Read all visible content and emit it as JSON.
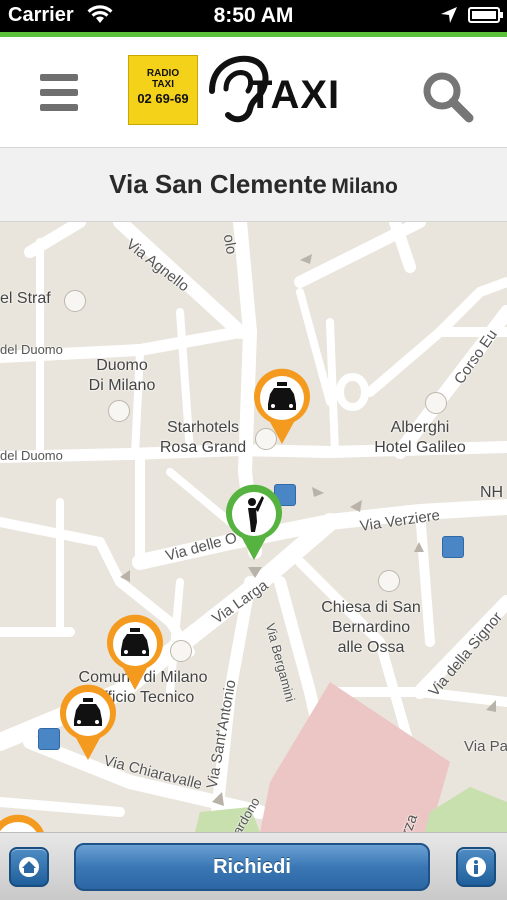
{
  "status_bar": {
    "carrier": "Carrier",
    "time": "8:50 AM"
  },
  "header": {
    "logo_badge_line1": "RADIO",
    "logo_badge_line2": "TAXI",
    "logo_badge_line3": "02 69-69",
    "logo_text": "TAXI"
  },
  "address": {
    "street": "Via San Clemente",
    "city": "Milano"
  },
  "map": {
    "pois": [
      "el Straf",
      "Duomo\nDi Milano",
      "Starhotels\nRosa Grand",
      "Alberghi\nHotel Galileo",
      "NH",
      "Chiesa di San\nBernardino\nalle Ossa",
      "Comune di Milano\nUfficio Tecnico"
    ],
    "roads": [
      "Via Agnello",
      "olo",
      "del Duomo",
      "del Duomo",
      "Corso Eu",
      "Via delle O",
      "Via Verziere",
      "Via Larga",
      "Via Bergamini",
      "Via della Signor",
      "Via Sant'Antonio",
      "Via Chiaravalle",
      "Via Pa",
      "ardono",
      "rza"
    ]
  },
  "footer": {
    "request_label": "Richiedi"
  },
  "colors": {
    "accent_green": "#5bbf3a",
    "taxi_pin": "#f39a1f",
    "user_pin": "#56b33f",
    "button_blue": "#3a77b4"
  }
}
